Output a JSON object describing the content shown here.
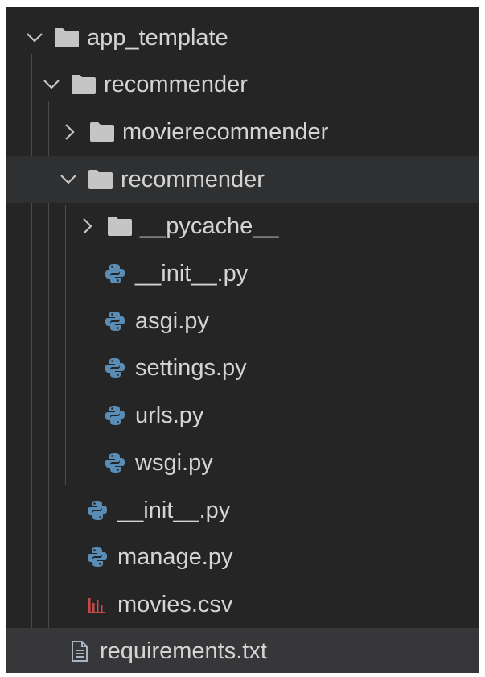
{
  "explorer": {
    "colors": {
      "background": "#252526",
      "text": "#d4d4d4",
      "folder": "#c5c5c5",
      "python": "#5a8db5",
      "csv": "#c64a4a",
      "txt": "#a9b4c2"
    },
    "tree": [
      {
        "label": "app_template",
        "type": "folder",
        "expanded": true
      },
      {
        "label": "recommender",
        "type": "folder",
        "expanded": true
      },
      {
        "label": "movierecommender",
        "type": "folder",
        "expanded": false
      },
      {
        "label": "recommender",
        "type": "folder",
        "expanded": true
      },
      {
        "label": "__pycache__",
        "type": "folder",
        "expanded": false
      },
      {
        "label": "__init__.py",
        "type": "python-file"
      },
      {
        "label": "asgi.py",
        "type": "python-file"
      },
      {
        "label": "settings.py",
        "type": "python-file"
      },
      {
        "label": "urls.py",
        "type": "python-file"
      },
      {
        "label": "wsgi.py",
        "type": "python-file"
      },
      {
        "label": "__init__.py",
        "type": "python-file"
      },
      {
        "label": "manage.py",
        "type": "python-file"
      },
      {
        "label": "movies.csv",
        "type": "csv-file"
      },
      {
        "label": "requirements.txt",
        "type": "txt-file"
      }
    ]
  }
}
